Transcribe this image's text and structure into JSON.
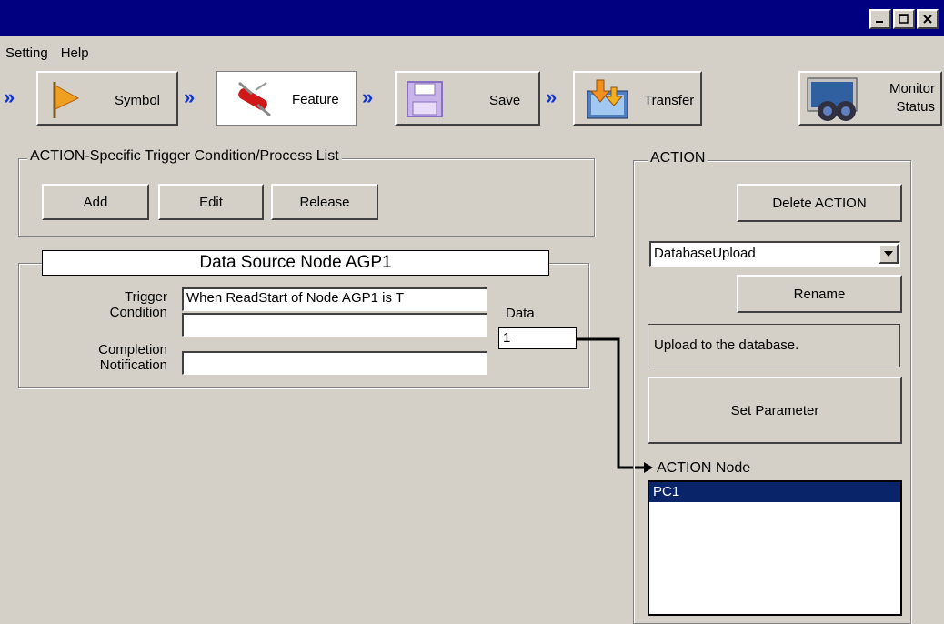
{
  "window": {
    "controls": [
      "_",
      "□",
      "×"
    ]
  },
  "menu": {
    "items": [
      "Setting",
      "Help"
    ]
  },
  "steps": {
    "items": [
      {
        "label": "Symbol",
        "icon": "flag-icon"
      },
      {
        "label": "Feature",
        "icon": "swiss-knife-icon"
      },
      {
        "label": "Save",
        "icon": "floppy-disk-icon"
      },
      {
        "label": "Transfer",
        "icon": "transfer-icon"
      }
    ],
    "monitor": {
      "line1": "Monitor",
      "line2": "Status",
      "icon": "binoculars-icon"
    },
    "chevron": "»"
  },
  "process_list": {
    "title": "ACTION-Specific Trigger Condition/Process List",
    "buttons": {
      "add": "Add",
      "edit": "Edit",
      "release": "Release"
    }
  },
  "node": {
    "title": "Data Source Node AGP1",
    "trigger_label_1": "Trigger",
    "trigger_label_2": "Condition",
    "trigger_value": "When ReadStart of Node AGP1 is T",
    "trigger_value_2": "",
    "completion_label_1": "Completion",
    "completion_label_2": "Notification",
    "completion_value": "",
    "data_label": "Data",
    "data_value": "1"
  },
  "action": {
    "title": "ACTION",
    "delete_button": "Delete ACTION",
    "select_value": "DatabaseUpload",
    "rename_button": "Rename",
    "description": "Upload to the database.",
    "set_parameter_button": "Set Parameter",
    "node_label": "ACTION Node",
    "nodes": [
      "PC1"
    ]
  },
  "colors": {
    "title_bar": "#000080",
    "selection": "#0a246a",
    "chevron": "#1033d8"
  }
}
